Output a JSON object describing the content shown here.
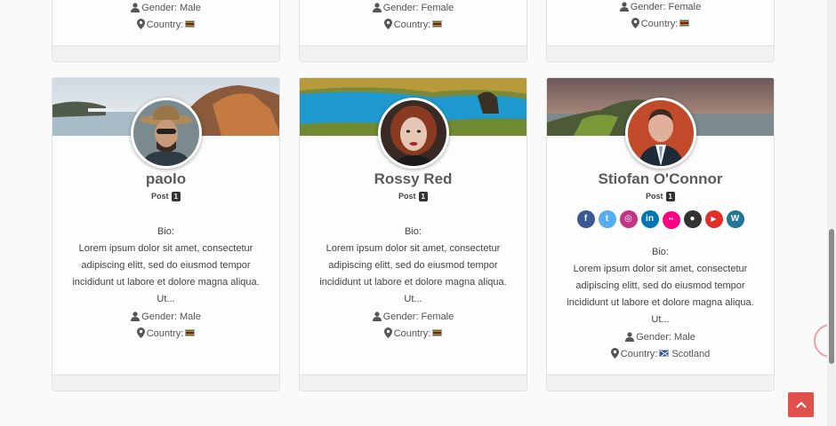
{
  "top_row": [
    {
      "gender": "Gender: Male",
      "country": "Country:"
    },
    {
      "gender": "Gender: Female",
      "country": "Country:"
    },
    {
      "gender": "Gender: Female",
      "country": "Country:"
    }
  ],
  "profiles": [
    {
      "name": "paolo",
      "post_label": "Post",
      "post_count": "1",
      "bio_label": "Bio:",
      "bio": "Lorem ipsum dolor sit amet, consectetur adipiscing elitt, sed do eiusmod tempor incididunt ut labore et dolore magna aliqua. Ut...",
      "gender": "Gender: Male",
      "country": "Country:"
    },
    {
      "name": "Rossy Red",
      "post_label": "Post",
      "post_count": "1",
      "bio_label": "Bio:",
      "bio": "Lorem ipsum dolor sit amet, consectetur adipiscing elitt, sed do eiusmod tempor incididunt ut labore et dolore magna aliqua. Ut...",
      "gender": "Gender: Female",
      "country": "Country:"
    },
    {
      "name": "Stiofan O'Connor",
      "post_label": "Post",
      "post_count": "1",
      "bio_label": "Bio:",
      "bio": "Lorem ipsum dolor sit amet, consectetur adipiscing elitt, sed do eiusmod tempor incididunt ut labore et dolore magna aliqua. Ut...",
      "gender": "Gender: Male",
      "country": "Country:",
      "country_name": "Scotland",
      "social": [
        {
          "icon": "facebook-icon",
          "glyph": "f",
          "color": "#3b5998"
        },
        {
          "icon": "twitter-icon",
          "glyph": "t",
          "color": "#55acee"
        },
        {
          "icon": "instagram-icon",
          "glyph": "◎",
          "color": "#c13584"
        },
        {
          "icon": "linkedin-icon",
          "glyph": "in",
          "color": "#0077b5"
        },
        {
          "icon": "flickr-icon",
          "glyph": "••",
          "color": "#ff0084"
        },
        {
          "icon": "github-icon",
          "glyph": "●",
          "color": "#333333"
        },
        {
          "icon": "youtube-icon",
          "glyph": "▶",
          "color": "#e52d27"
        },
        {
          "icon": "wordpress-icon",
          "glyph": "W",
          "color": "#21759b"
        }
      ]
    }
  ],
  "back_to_top": {
    "icon": "chevron-up-icon"
  }
}
